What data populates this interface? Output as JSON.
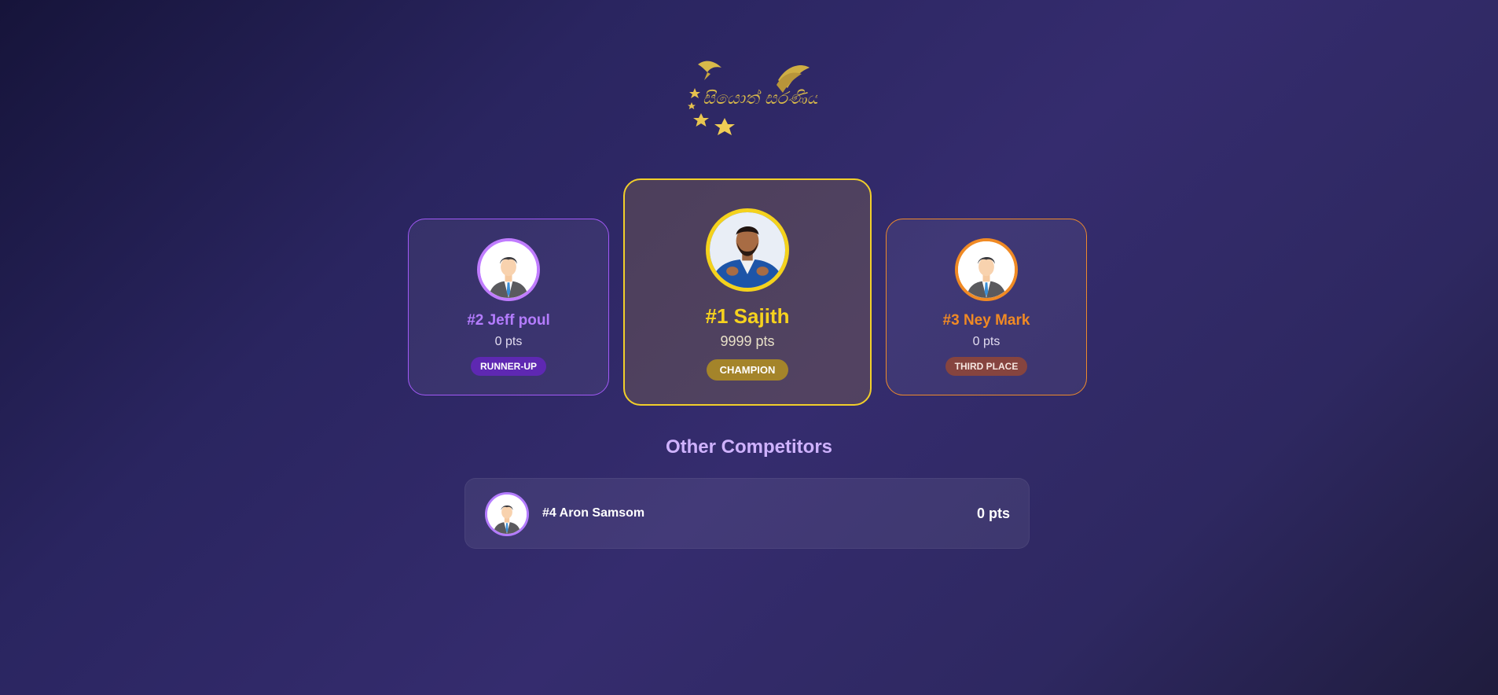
{
  "logo": {
    "alt": "සියොත් සරණිය"
  },
  "podium": {
    "first": {
      "name": "#1 Sajith",
      "points": "9999 pts",
      "badge": "CHAMPION"
    },
    "second": {
      "name": "#2 Jeff poul",
      "points": "0 pts",
      "badge": "RUNNER-UP"
    },
    "third": {
      "name": "#3 Ney Mark",
      "points": "0 pts",
      "badge": "THIRD PLACE"
    }
  },
  "others": {
    "title": "Other Competitors",
    "rows": [
      {
        "name": "#4 Aron Samsom",
        "points": "0 pts"
      }
    ]
  },
  "colors": {
    "gold": "#f4d21c",
    "purple": "#b47cff",
    "orange": "#f08a24",
    "background": "#2a2560"
  },
  "icons": {
    "default_avatar": "businessman-avatar-icon",
    "champion_avatar": "profile-photo"
  }
}
